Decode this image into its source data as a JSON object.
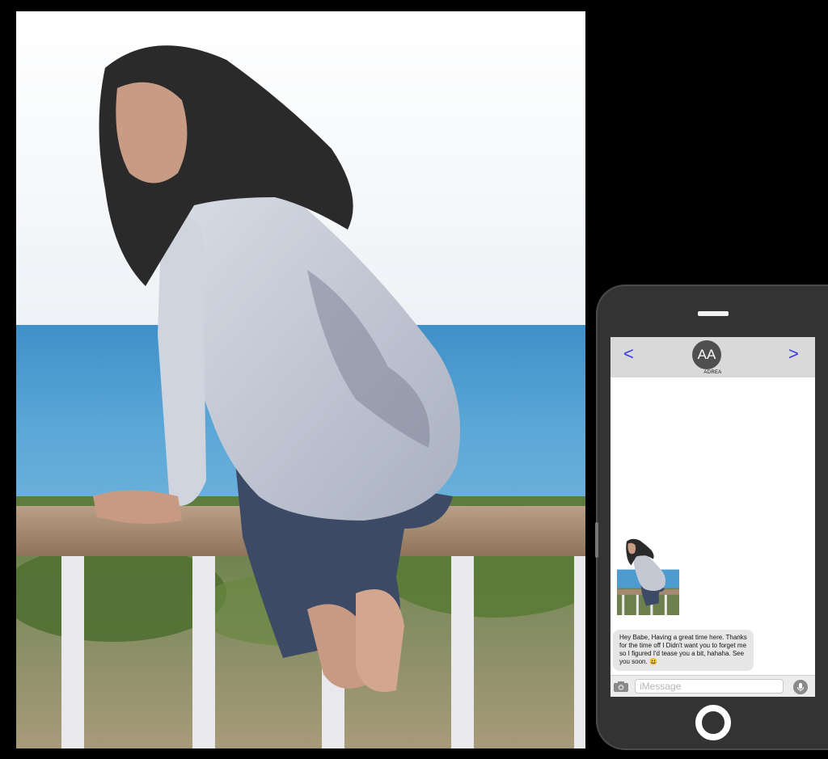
{
  "phone": {
    "contact_initials": "AA",
    "contact_name": "ADREA",
    "nav_back_glyph": "<",
    "nav_forward_glyph": ">",
    "message_text": "Hey Babe, Having a great time here. Thanks for the time off I Didn't want you to forget me so I figured I'd tease you a bit, hahaha. See you soon.",
    "message_emoji": "😃",
    "input_placeholder": "iMessage",
    "icons": [
      "camera-icon",
      "microphone-icon",
      "home-button"
    ]
  },
  "colors": {
    "nav_arrow": "#3a3ae6",
    "header_bg": "#d9d9d9",
    "bubble_bg": "#e6e6e6",
    "phone_body": "#333333"
  }
}
